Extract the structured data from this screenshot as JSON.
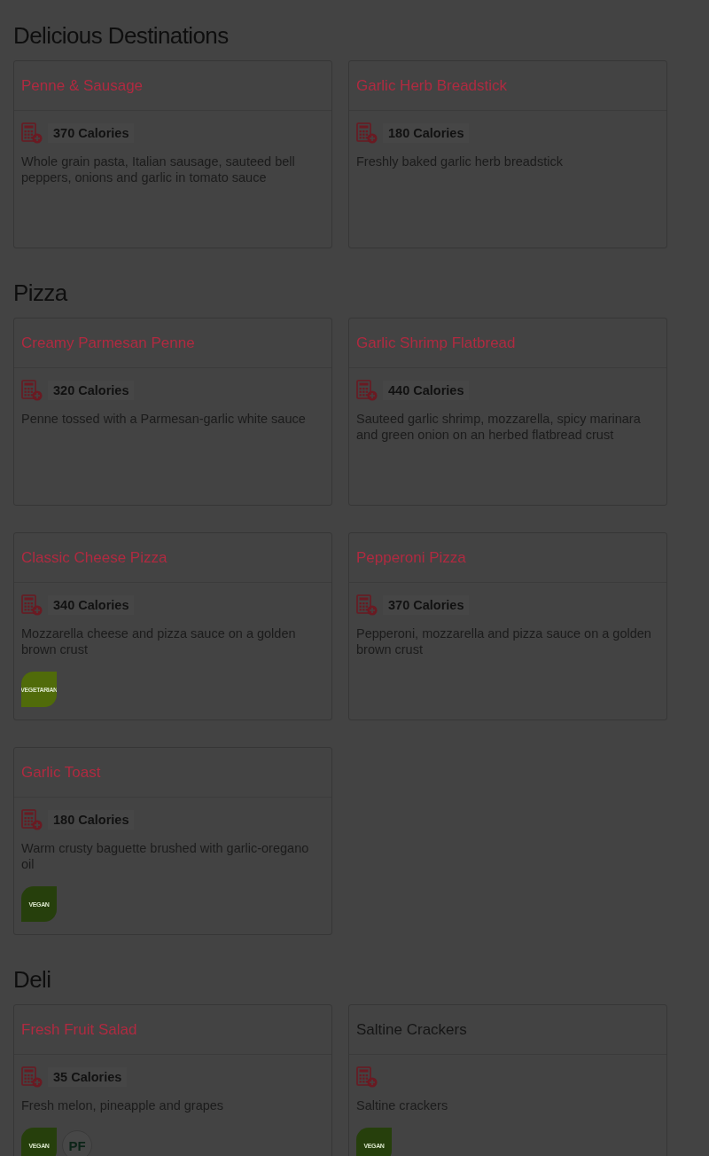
{
  "sections": [
    {
      "heading": "Delicious Destinations",
      "items": [
        {
          "title": "Penne & Sausage",
          "link": true,
          "calories": "370 Calories",
          "description": "Whole grain pasta, Italian sausage, sauteed bell peppers, onions and garlic in tomato sauce"
        },
        {
          "title": "Garlic Herb Breadstick",
          "link": true,
          "calories": "180 Calories",
          "description": "Freshly baked garlic herb breadstick"
        }
      ]
    },
    {
      "heading": "Pizza",
      "items": [
        {
          "title": "Creamy Parmesan Penne",
          "link": true,
          "calories": "320 Calories",
          "description": "Penne tossed with a Parmesan-garlic white sauce"
        },
        {
          "title": "Garlic Shrimp Flatbread",
          "link": true,
          "calories": "440 Calories",
          "description": "Sauteed garlic shrimp, mozzarella, spicy marinara and green onion on an herbed flatbread crust"
        },
        {
          "title": "Classic Cheese Pizza",
          "link": true,
          "calories": "340 Calories",
          "description": "Mozzarella cheese and pizza sauce on a golden brown crust",
          "badges": [
            {
              "kind": "vegetarian",
              "label": "VEGETARIAN"
            }
          ]
        },
        {
          "title": "Pepperoni Pizza",
          "link": true,
          "calories": "370 Calories",
          "description": "Pepperoni, mozzarella and pizza sauce on a golden brown crust"
        },
        {
          "title": "Garlic Toast",
          "link": true,
          "calories": "180 Calories",
          "description": "Warm crusty baguette brushed with garlic-oregano oil",
          "badges": [
            {
              "kind": "vegan",
              "label": "VEGAN"
            }
          ]
        }
      ]
    },
    {
      "heading": "Deli",
      "items": [
        {
          "title": "Fresh Fruit Salad",
          "link": true,
          "calories": "35 Calories",
          "description": "Fresh melon, pineapple and grapes",
          "badges": [
            {
              "kind": "vegan",
              "label": "VEGAN"
            },
            {
              "kind": "plant_forward",
              "label": "PF"
            }
          ]
        },
        {
          "title": "Saltine Crackers",
          "link": false,
          "description": "Saltine crackers",
          "badges": [
            {
              "kind": "vegan",
              "label": "VEGAN"
            }
          ]
        }
      ]
    }
  ]
}
